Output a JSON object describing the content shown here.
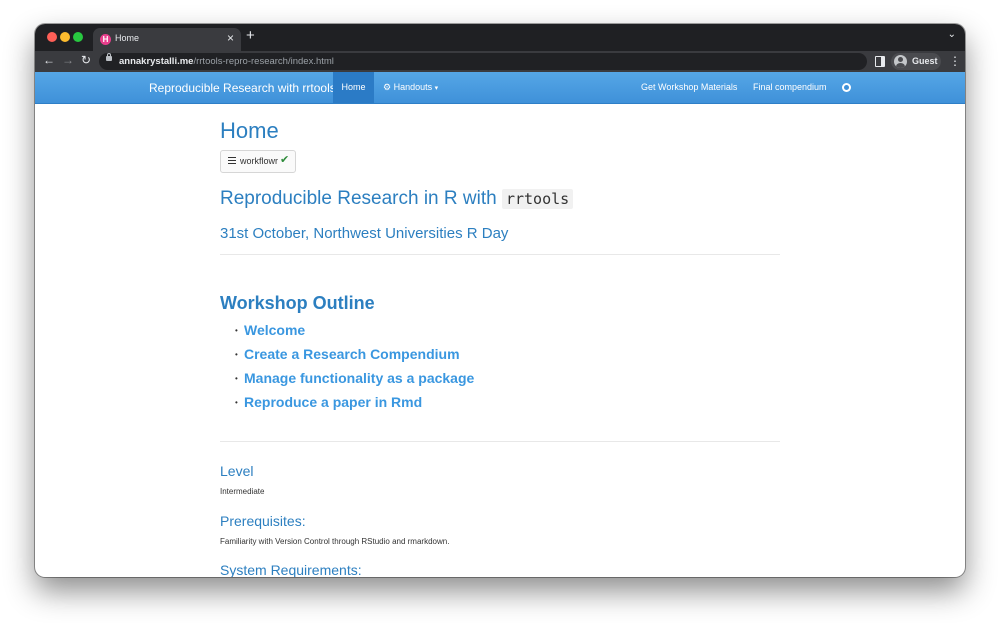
{
  "browser": {
    "tab_title": "Home",
    "favicon_letter": "H",
    "url_host": "annakrystalli.me",
    "url_path": "/rrtools-repro-research/index.html",
    "profile_name": "Guest"
  },
  "navbar": {
    "brand": "Reproducible Research with rrtools",
    "home": "Home",
    "handouts": "Handouts",
    "get_materials": "Get Workshop Materials",
    "final_compendium": "Final compendium"
  },
  "page": {
    "title": "Home",
    "workflowr_label": "workflowr",
    "heading_text": "Reproducible Research in R with",
    "heading_code": "rrtools",
    "date_line": "31st October, Northwest Universities R Day",
    "outline_title": "Workshop Outline",
    "outline_items": [
      "Welcome",
      "Create a Research Compendium",
      "Manage functionality as a package",
      "Reproduce a paper in Rmd"
    ],
    "level_title": "Level",
    "level_text": "Intermediate",
    "prereq_title": "Prerequisites:",
    "prereq_text": "Familiarity with Version Control through RStudio and rmarkdown.",
    "sysreq_title": "System Requirements:"
  },
  "colors": {
    "navbar": "#3f91d9",
    "heading": "#2c7fc0",
    "link": "#3a97e0"
  }
}
